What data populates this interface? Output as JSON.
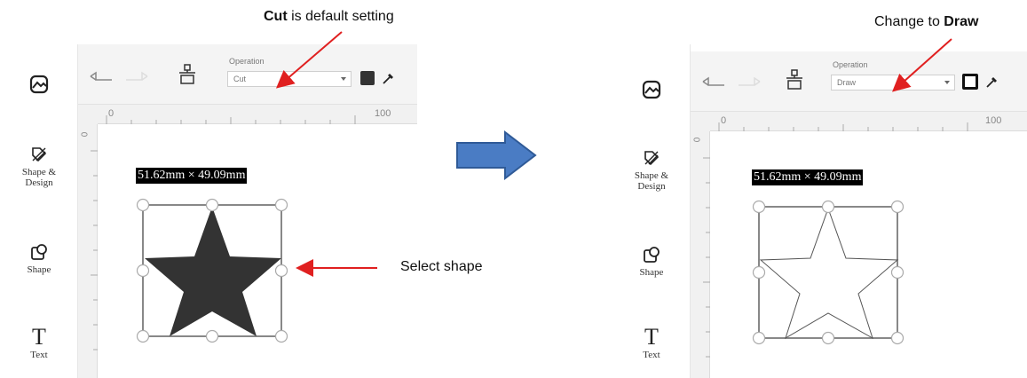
{
  "annotations": {
    "cut_bold": "Cut",
    "cut_rest": " is default setting",
    "draw_prefix": "Change to ",
    "draw_bold": "Draw",
    "select_shape": "Select shape"
  },
  "colors": {
    "arrow_red": "#e02020",
    "arrow_blue": "#4a7cc4",
    "shape_fill": "#333333"
  },
  "before": {
    "operation_label": "Operation",
    "operation_value": "Cut",
    "ruler_top_start": "0",
    "ruler_top_end": "100",
    "ruler_left_start": "0",
    "dimensions": "51.62mm × 49.09mm",
    "sidebar": [
      {
        "label": "",
        "icon": "image-icon"
      },
      {
        "label": "Shape &\nDesign",
        "icon": "shape-design-icon"
      },
      {
        "label": "Shape",
        "icon": "shape-icon"
      },
      {
        "label": "Text",
        "icon": "text-icon"
      }
    ]
  },
  "after": {
    "operation_label": "Operation",
    "operation_value": "Draw",
    "ruler_top_start": "0",
    "ruler_top_end": "100",
    "ruler_left_start": "0",
    "dimensions": "51.62mm × 49.09mm",
    "sidebar": [
      {
        "label": "",
        "icon": "image-icon"
      },
      {
        "label": "Shape &\nDesign",
        "icon": "shape-design-icon"
      },
      {
        "label": "Shape",
        "icon": "shape-icon"
      },
      {
        "label": "Text",
        "icon": "text-icon"
      }
    ]
  },
  "text_icon_glyph": "T"
}
